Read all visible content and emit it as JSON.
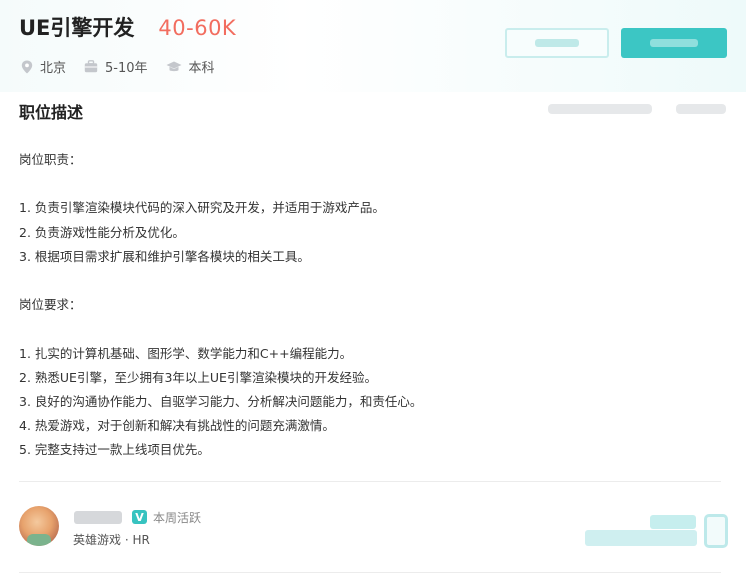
{
  "job": {
    "title": "UE引擎开发",
    "salary": "40-60K",
    "location": "北京",
    "experience": "5-10年",
    "education": "本科"
  },
  "icons": {
    "location": "location-pin-icon",
    "experience": "briefcase-icon",
    "education": "graduation-cap-icon"
  },
  "section": {
    "title": "职位描述"
  },
  "description": {
    "duties_heading": "岗位职责：",
    "duties": [
      "1. 负责引擎渲染模块代码的深入研究及开发，并适用于游戏产品。",
      "2. 负责游戏性能分析及优化。",
      "3. 根据项目需求扩展和维护引擎各模块的相关工具。"
    ],
    "requirements_heading": "岗位要求：",
    "requirements": [
      "1. 扎实的计算机基础、图形学、数学能力和C++编程能力。",
      "2. 熟悉UE引擎，至少拥有3年以上UE引擎渲染模块的开发经验。",
      "3. 良好的沟通协作能力、自驱学习能力、分析解决问题能力，和责任心。",
      "4. 热爱游戏，对于创新和解决有挑战性的问题充满激情。",
      "5. 完整支持过一款上线项目优先。"
    ]
  },
  "recruiter": {
    "badge": "V",
    "activity": "本周活跃",
    "company": "英雄游戏 · HR"
  },
  "colors": {
    "accent": "#3cc6c4",
    "salary": "#f26d5f"
  }
}
